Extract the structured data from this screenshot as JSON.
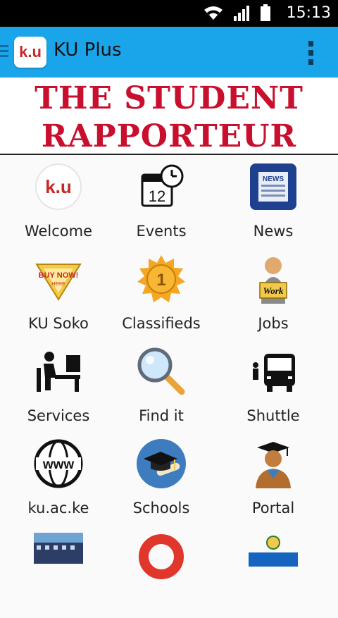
{
  "status_bar": {
    "time": "15:13"
  },
  "app_bar": {
    "logo_text": "k.u",
    "title": "KU Plus"
  },
  "banner": {
    "line1": "THE STUDENT",
    "line2": "RAPPORTEUR"
  },
  "grid": {
    "items": [
      {
        "label": "Welcome",
        "icon": "ku-logo-icon"
      },
      {
        "label": "Events",
        "icon": "calendar-clock-icon"
      },
      {
        "label": "News",
        "icon": "newspaper-icon"
      },
      {
        "label": "KU Soko",
        "icon": "buy-now-tag-icon"
      },
      {
        "label": "Classifieds",
        "icon": "gold-medal-icon"
      },
      {
        "label": "Jobs",
        "icon": "worker-icon"
      },
      {
        "label": "Services",
        "icon": "office-desk-icon"
      },
      {
        "label": "Find it",
        "icon": "magnifier-icon"
      },
      {
        "label": "Shuttle",
        "icon": "bus-icon"
      },
      {
        "label": "ku.ac.ke",
        "icon": "www-globe-icon"
      },
      {
        "label": "Schools",
        "icon": "graduation-cap-icon"
      },
      {
        "label": "Portal",
        "icon": "graduate-icon"
      },
      {
        "label": "",
        "icon": "building-photo-icon"
      },
      {
        "label": "",
        "icon": "red-ring-icon"
      },
      {
        "label": "",
        "icon": "kusa-logo-icon"
      }
    ],
    "icon_texts": {
      "welcome": "k.u",
      "events": "12",
      "news": "NEWS",
      "soko": "BUY NOW!",
      "soko_sub": "HERE",
      "classifieds": "1",
      "jobs": "Work",
      "www": "www"
    }
  },
  "colors": {
    "app_bar": "#1aa5ea",
    "banner_text": "#c8102e",
    "status_bar": "#000000"
  }
}
